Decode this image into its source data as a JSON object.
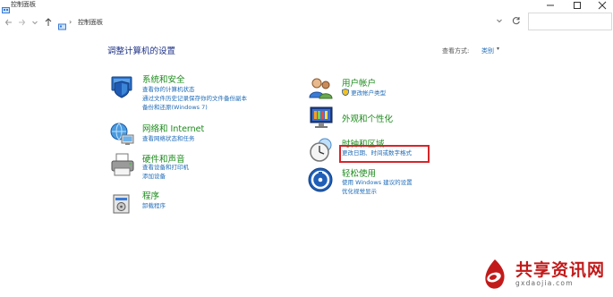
{
  "window": {
    "title": "控制面板",
    "minimize_icon": "minimize-icon",
    "maximize_icon": "maximize-icon",
    "close_icon": "close-icon"
  },
  "addressbar": {
    "path": "控制面板",
    "search_placeholder": ""
  },
  "header": {
    "title": "调整计算机的设置",
    "view_by_label": "查看方式:",
    "view_by_value": "类别"
  },
  "categories": [
    {
      "title": "系统和安全",
      "icon": "shield-monitor-icon",
      "links": [
        "查看你的计算机状态",
        "通过文件历史记录保存你的文件备份副本",
        "备份和还原(Windows 7)"
      ]
    },
    {
      "title": "网络和 Internet",
      "icon": "network-globe-icon",
      "links": [
        "查看网络状态和任务"
      ]
    },
    {
      "title": "硬件和声音",
      "icon": "printer-icon",
      "links": [
        "查看设备和打印机",
        "添加设备"
      ]
    },
    {
      "title": "程序",
      "icon": "programs-icon",
      "links": [
        "卸载程序"
      ]
    },
    {
      "title": "用户帐户",
      "icon": "users-icon",
      "links": [
        "更改帐户类型"
      ]
    },
    {
      "title": "外观和个性化",
      "icon": "appearance-monitor-icon",
      "links": []
    },
    {
      "title": "时钟和区域",
      "icon": "clock-globe-icon",
      "links": [
        "更改日期、时间或数字格式"
      ]
    },
    {
      "title": "轻松使用",
      "icon": "ease-of-access-icon",
      "links": [
        "使用 Windows 建议的设置",
        "优化视觉显示"
      ]
    }
  ],
  "watermark": {
    "name": "共享资讯网",
    "url": "gxdaojia.com"
  },
  "colors": {
    "category_title": "#1a8a1a",
    "link": "#1e6bb8",
    "highlight": "#d6252a",
    "watermark": "#c21a1a"
  }
}
